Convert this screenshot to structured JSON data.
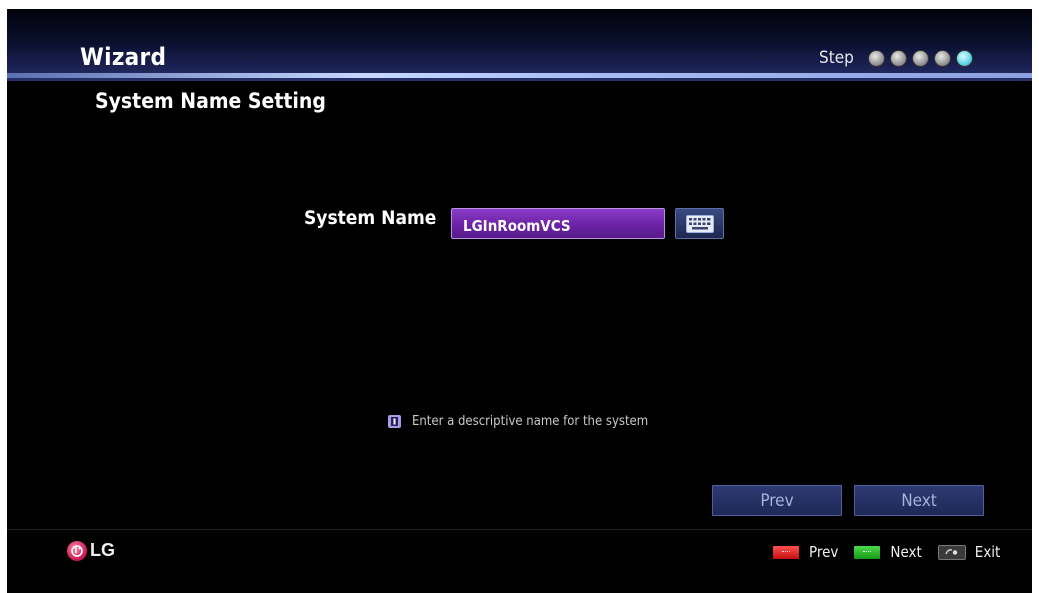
{
  "header": {
    "title": "Wizard",
    "step_label": "Step",
    "steps_total": 5,
    "current_step": 5
  },
  "page": {
    "title": "System Name Setting"
  },
  "form": {
    "field_label": "System Name",
    "field_value": "LGInRoomVCS",
    "keyboard_icon": "keyboard-icon"
  },
  "hint": {
    "icon": "info-icon",
    "text": "Enter a descriptive name for the system"
  },
  "nav": {
    "prev_label": "Prev",
    "next_label": "Next"
  },
  "footer": {
    "brand": "LG",
    "legend": {
      "prev_label": "Prev",
      "next_label": "Next",
      "exit_label": "Exit"
    }
  },
  "colors": {
    "input_purple": "#6b22a6",
    "nav_button": "#1e2857",
    "active_step": "#5ed6e6",
    "key_red": "#d01818",
    "key_green": "#1fae1f"
  }
}
